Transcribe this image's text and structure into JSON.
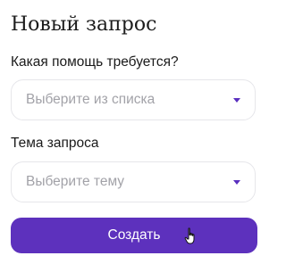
{
  "form": {
    "title": "Новый запрос",
    "help_field": {
      "label": "Какая помощь требуется?",
      "placeholder": "Выберите из списка",
      "chevron_icon": "chevron-down-icon"
    },
    "topic_field": {
      "label": "Тема запроса",
      "placeholder": "Выберите тему",
      "chevron_icon": "chevron-down-icon"
    },
    "submit_label": "Создать"
  },
  "cursor": {
    "icon": "hand-pointer-icon"
  },
  "colors": {
    "accent": "#5d31bd",
    "chevron": "#5a2fbf",
    "placeholder_text": "#a2a2a8",
    "field_border": "#e6e6ea"
  }
}
